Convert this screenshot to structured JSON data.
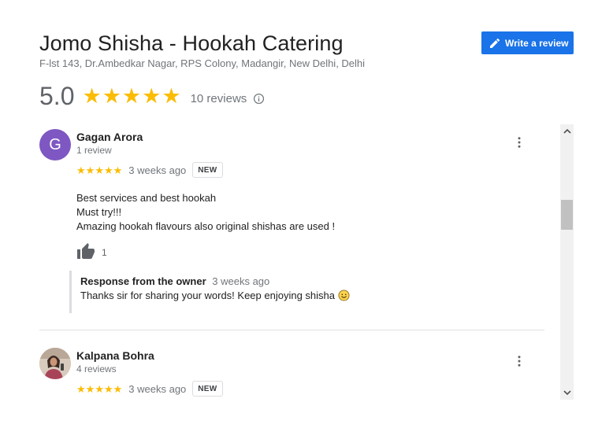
{
  "business": {
    "name": "Jomo Shisha - Hookah Catering",
    "address": "F-lst 143, Dr.Ambedkar Nagar, RPS Colony, Madangir, New Delhi, Delhi"
  },
  "write_review_label": "Write a review",
  "summary": {
    "rating": "5.0",
    "stars": 5,
    "reviews_count": "10 reviews"
  },
  "reviews": [
    {
      "avatar_letter": "G",
      "avatar_color": "#7e57c2",
      "name": "Gagan Arora",
      "meta": "1 review",
      "stars": 5,
      "time": "3 weeks ago",
      "badge": "NEW",
      "text": [
        "Best services and best hookah",
        "Must try!!!",
        "Amazing hookah flavours also original shishas are used !"
      ],
      "likes": "1",
      "owner_response": {
        "title": "Response from the owner",
        "time": "3 weeks ago",
        "text": "Thanks sir for sharing your words! Keep enjoying shisha"
      }
    },
    {
      "name": "Kalpana Bohra",
      "meta": "4 reviews",
      "stars": 5,
      "time": "3 weeks ago",
      "badge": "NEW"
    }
  ],
  "colors": {
    "accent": "#1a73e8",
    "star": "#fbbc04",
    "muted_text": "#70757a"
  },
  "icons": {
    "write": "pencil-icon",
    "info": "info-icon",
    "more": "more-vert-icon",
    "like": "thumbs-up-icon",
    "emoji": "smiley-emoji-icon"
  }
}
